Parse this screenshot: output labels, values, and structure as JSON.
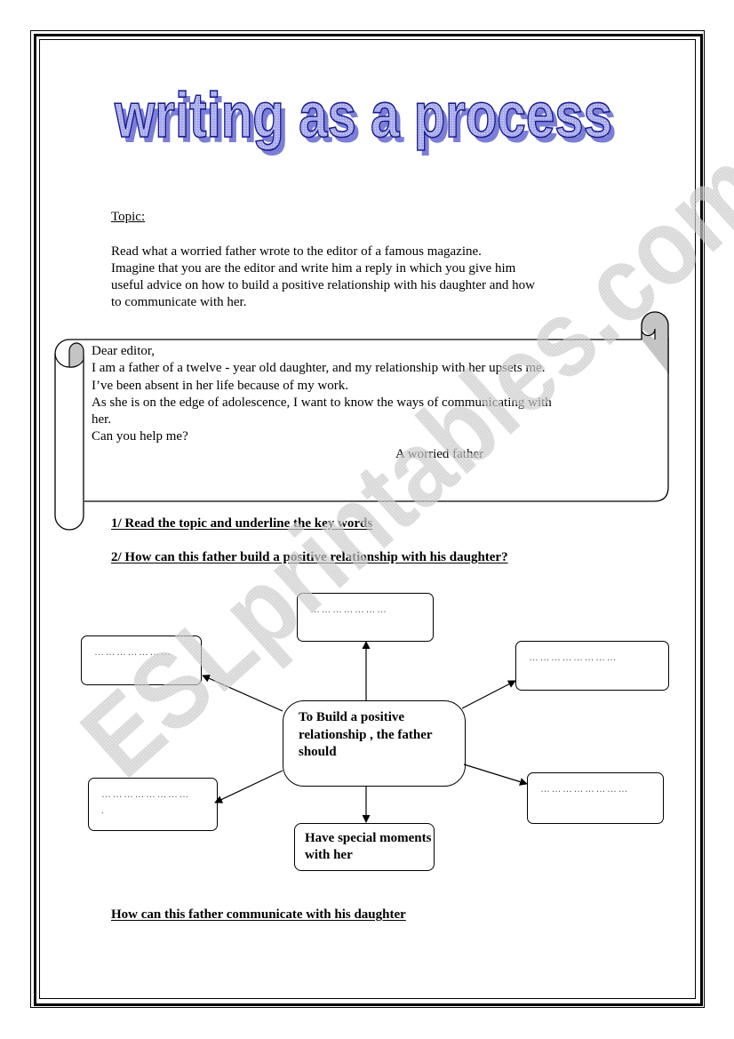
{
  "title": "writing as a process",
  "colors": {
    "title_fill": "#9a9ee0",
    "title_outline": "#1a1a8a",
    "title_shadow": "#7b7fd6",
    "watermark": "#c8c8c8",
    "scroll_curl": "#c0c0c0"
  },
  "topic": {
    "label": "Topic:",
    "lines": [
      "Read what a worried father wrote to the editor of a famous magazine.",
      "Imagine that you are the editor and write him a reply in which you give him",
      "useful advice on how to build a positive relationship with his daughter and how",
      "to communicate with her."
    ]
  },
  "letter": {
    "lines": [
      "Dear editor,",
      "I am a father of a twelve - year old daughter, and my relationship with her upsets me.",
      "I’ve been absent in her life because of my work.",
      "As she is on the edge of adolescence, I want to know the ways of communicating with",
      "her.",
      "Can you help me?"
    ],
    "signature": "A worried father"
  },
  "questions": {
    "q1": "1/ Read the topic and underline the key words",
    "q2": "2/ How can this father build a positive relationship with his daughter?",
    "q3": "How can this father communicate with his daughter"
  },
  "diagram": {
    "center": "To Build  a positive relationship , the father should",
    "blank_dots": "…………………",
    "blank_dots_long": "……………………",
    "extra_dot": ".",
    "filled": "Have special moments with her"
  },
  "watermark": "ESLprintables.com"
}
